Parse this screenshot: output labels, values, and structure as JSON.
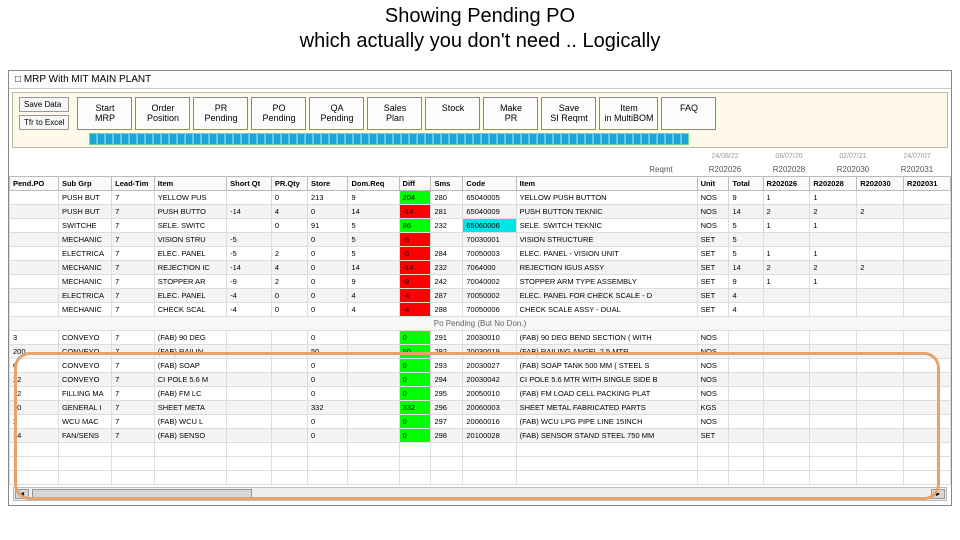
{
  "title_line1": "Showing Pending PO",
  "title_line2": "which actually you don't need .. Logically",
  "window_title": "MRP With MIT MAIN PLANT",
  "side_buttons": {
    "save": "Save Data",
    "excel": "Tfr to Excel"
  },
  "buttons": [
    "Start MRP",
    "Order Position",
    "PR Pending",
    "PO Pending",
    "QA Pending",
    "Sales Plan",
    "Stock",
    "Make PR",
    "Save SI Reqmt",
    "Item in MultiBOM",
    "FAQ"
  ],
  "req_dates": [
    "24/08/22",
    "08/07/20",
    "02/07/21",
    "24/07/07"
  ],
  "req_labels": [
    "Reqmt",
    "R202026",
    "R202028",
    "R202030",
    "R202031"
  ],
  "columns": [
    "Pend.PO",
    "Sub Grp",
    "Lead-Tim",
    "Item",
    "Short Qt",
    "PR.Qty",
    "Store",
    "Dom.Req",
    "Diff",
    "Sms",
    "Code",
    "Item",
    "Unit",
    "Total",
    "R202026",
    "R202028",
    "R202030",
    "R202031"
  ],
  "section_label": "Po Pending (But No Don.)",
  "rows_top": [
    {
      "po": "",
      "grp": "PUSH BUT",
      "lt": "7",
      "item": "YELLOW PUS",
      "sq": "",
      "pr": "0",
      "st": "213",
      "dr": "9",
      "diff": "204",
      "dc": "g",
      "sms": "280",
      "code": "65040005",
      "cdc": "",
      "desc": "YELLOW PUSH BUTTON",
      "u": "NOS",
      "t": "9",
      "r1": "1",
      "r2": "1",
      "r3": "",
      "r4": ""
    },
    {
      "po": "",
      "grp": "PUSH BUT",
      "lt": "7",
      "item": "PUSH BUTTO",
      "sq": "-14",
      "pr": "4",
      "st": "0",
      "dr": "14",
      "diff": "-14",
      "dc": "r",
      "sms": "281",
      "code": "65040009",
      "cdc": "",
      "desc": "PUSH BUTTON TEKNIC",
      "u": "NOS",
      "t": "14",
      "r1": "2",
      "r2": "2",
      "r3": "2",
      "r4": ""
    },
    {
      "po": "",
      "grp": "SWITCHE",
      "lt": "7",
      "item": "SELE. SWITC",
      "sq": "",
      "pr": "0",
      "st": "91",
      "dr": "5",
      "diff": "86",
      "dc": "g",
      "sms": "232",
      "code": "65060006",
      "cdc": "c",
      "desc": "SELE. SWITCH TEKNIC",
      "u": "NOS",
      "t": "5",
      "r1": "1",
      "r2": "1",
      "r3": "",
      "r4": ""
    },
    {
      "po": "",
      "grp": "MECHANIC",
      "lt": "7",
      "item": "VISION STRU",
      "sq": "-5",
      "pr": "",
      "st": "0",
      "dr": "5",
      "diff": "-5",
      "dc": "r",
      "sms": "",
      "code": "70030001",
      "cdc": "",
      "desc": "VISION STRUCTURE",
      "u": "SET",
      "t": "5",
      "r1": "",
      "r2": "",
      "r3": "",
      "r4": ""
    },
    {
      "po": "",
      "grp": "ELECTRICA",
      "lt": "7",
      "item": "ELEC. PANEL",
      "sq": "-5",
      "pr": "2",
      "st": "0",
      "dr": "5",
      "diff": "-5",
      "dc": "r",
      "sms": "284",
      "code": "70050003",
      "cdc": "",
      "desc": "ELEC. PANEL - VISION UNIT",
      "u": "SET",
      "t": "5",
      "r1": "1",
      "r2": "1",
      "r3": "",
      "r4": ""
    },
    {
      "po": "",
      "grp": "MECHANIC",
      "lt": "7",
      "item": "REJECTION IC",
      "sq": "-14",
      "pr": "4",
      "st": "0",
      "dr": "14",
      "diff": "-14",
      "dc": "r",
      "sms": "232",
      "code": "7064000",
      "cdc": "",
      "desc": "REJECTION IGUS ASSY",
      "u": "SET",
      "t": "14",
      "r1": "2",
      "r2": "2",
      "r3": "2",
      "r4": ""
    },
    {
      "po": "",
      "grp": "MECHANIC",
      "lt": "7",
      "item": "STOPPER AR",
      "sq": "-9",
      "pr": "2",
      "st": "0",
      "dr": "9",
      "diff": "-9",
      "dc": "r",
      "sms": "242",
      "code": "70040002",
      "cdc": "",
      "desc": "STOPPER ARM TYPE ASSEMBLY",
      "u": "SET",
      "t": "9",
      "r1": "1",
      "r2": "1",
      "r3": "",
      "r4": ""
    },
    {
      "po": "",
      "grp": "ELECTRICA",
      "lt": "7",
      "item": "ELEC. PANEL",
      "sq": "-4",
      "pr": "0",
      "st": "0",
      "dr": "4",
      "diff": "-4",
      "dc": "r",
      "sms": "287",
      "code": "70050002",
      "cdc": "",
      "desc": "ELEC. PANEL FOR CHECK SCALE - D",
      "u": "SET",
      "t": "4",
      "r1": "",
      "r2": "",
      "r3": "",
      "r4": ""
    },
    {
      "po": "",
      "grp": "MECHANIC",
      "lt": "7",
      "item": "CHECK SCAL",
      "sq": "-4",
      "pr": "0",
      "st": "0",
      "dr": "4",
      "diff": "-4",
      "dc": "r",
      "sms": "288",
      "code": "70050006",
      "cdc": "",
      "desc": "CHECK SCALE ASSY - DUAL",
      "u": "SET",
      "t": "4",
      "r1": "",
      "r2": "",
      "r3": "",
      "r4": ""
    }
  ],
  "rows_bottom": [
    {
      "po": "3",
      "grp": "CONVEYO",
      "lt": "7",
      "item": "(FAB) 90 DEG",
      "sq": "",
      "pr": "",
      "st": "0",
      "dr": "",
      "diff": "0",
      "dc": "g",
      "sms": "291",
      "code": "20030010",
      "cdc": "",
      "desc": "(FAB) 90 DEG BEND SECTION ( WITH",
      "u": "NOS",
      "t": "",
      "r1": "",
      "r2": "",
      "r3": "",
      "r4": ""
    },
    {
      "po": "200",
      "grp": "CONVEYO",
      "lt": "7",
      "item": "(FAB) RAILIN",
      "sq": "",
      "pr": "",
      "st": "50",
      "dr": "",
      "diff": "50",
      "dc": "g",
      "sms": "292",
      "code": "20030019",
      "cdc": "",
      "desc": "(FAB) RAILING ANGEL 2.5 MTR",
      "u": "NOS",
      "t": "",
      "r1": "",
      "r2": "",
      "r3": "",
      "r4": ""
    },
    {
      "po": "6",
      "grp": "CONVEYO",
      "lt": "7",
      "item": "(FAB) SOAP",
      "sq": "",
      "pr": "",
      "st": "0",
      "dr": "",
      "diff": "0",
      "dc": "g",
      "sms": "293",
      "code": "20030027",
      "cdc": "",
      "desc": "(FAB) SOAP TANK 500 MM ( STEEL S",
      "u": "NOS",
      "t": "",
      "r1": "",
      "r2": "",
      "r3": "",
      "r4": ""
    },
    {
      "po": "22",
      "grp": "CONVEYO",
      "lt": "7",
      "item": "CI POLE 5.6 M",
      "sq": "",
      "pr": "",
      "st": "0",
      "dr": "",
      "diff": "0",
      "dc": "g",
      "sms": "294",
      "code": "20030042",
      "cdc": "",
      "desc": "CI POLE 5.6 MTR WITH SINGLE SIDE B",
      "u": "NOS",
      "t": "",
      "r1": "",
      "r2": "",
      "r3": "",
      "r4": ""
    },
    {
      "po": "12",
      "grp": "FILLING MA",
      "lt": "7",
      "item": "(FAB) FM LC",
      "sq": "",
      "pr": "",
      "st": "0",
      "dr": "",
      "diff": "0",
      "dc": "g",
      "sms": "295",
      "code": "20050010",
      "cdc": "",
      "desc": "(FAB) FM LOAD CELL PACKING PLAT",
      "u": "NOS",
      "t": "",
      "r1": "",
      "r2": "",
      "r3": "",
      "r4": ""
    },
    {
      "po": "10",
      "grp": "GENERAL I",
      "lt": "7",
      "item": "SHEET META",
      "sq": "",
      "pr": "",
      "st": "332",
      "dr": "",
      "diff": "332",
      "dc": "g",
      "sms": "296",
      "code": "20060003",
      "cdc": "",
      "desc": "SHEET METAL FABRICATED PARTS",
      "u": "KGS",
      "t": "",
      "r1": "",
      "r2": "",
      "r3": "",
      "r4": ""
    },
    {
      "po": "2",
      "grp": "WCU MAC",
      "lt": "7",
      "item": "(FAB) WCU L",
      "sq": "",
      "pr": "",
      "st": "0",
      "dr": "",
      "diff": "0",
      "dc": "g",
      "sms": "297",
      "code": "20060016",
      "cdc": "",
      "desc": "(FAB) WCU LPG PIPE LINE 15INCH",
      "u": "NOS",
      "t": "",
      "r1": "",
      "r2": "",
      "r3": "",
      "r4": ""
    },
    {
      "po": "14",
      "grp": "FAN/SENS",
      "lt": "7",
      "item": "(FAB) SENSO",
      "sq": "",
      "pr": "",
      "st": "0",
      "dr": "",
      "diff": "0",
      "dc": "g",
      "sms": "298",
      "code": "20100028",
      "cdc": "",
      "desc": "(FAB) SENSOR STAND STEEL 750 MM",
      "u": "SET",
      "t": "",
      "r1": "",
      "r2": "",
      "r3": "",
      "r4": ""
    }
  ]
}
